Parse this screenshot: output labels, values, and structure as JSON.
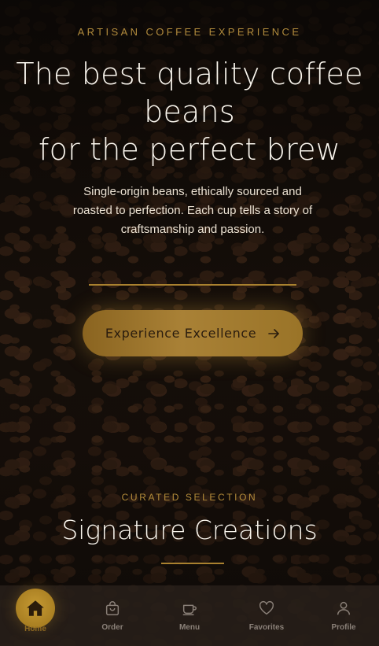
{
  "hero": {
    "eyebrow": "ARTISAN COFFEE EXPERIENCE",
    "title_line1": "The best quality coffee",
    "title_line2": "beans",
    "title_line3": "for the perfect brew",
    "subtitle": "Single-origin beans, ethically sourced and roasted to perfection. Each cup tells a story of craftsmanship and passion.",
    "cta_label": "Experience Excellence",
    "cta_icon": "arrow-right-icon"
  },
  "section": {
    "eyebrow": "CURATED SELECTION",
    "title": "Signature Creations"
  },
  "colors": {
    "accent": "#a9812f",
    "background": "#120d09",
    "nav_background": "#28201a",
    "active_nav": "#c69a33"
  },
  "nav": {
    "items": [
      {
        "label": "Home",
        "icon": "home-icon",
        "active": true
      },
      {
        "label": "Order",
        "icon": "shopping-bag-icon",
        "active": false
      },
      {
        "label": "Menu",
        "icon": "coffee-cup-icon",
        "active": false
      },
      {
        "label": "Favorites",
        "icon": "heart-icon",
        "active": false
      },
      {
        "label": "Profile",
        "icon": "user-icon",
        "active": false
      }
    ]
  }
}
